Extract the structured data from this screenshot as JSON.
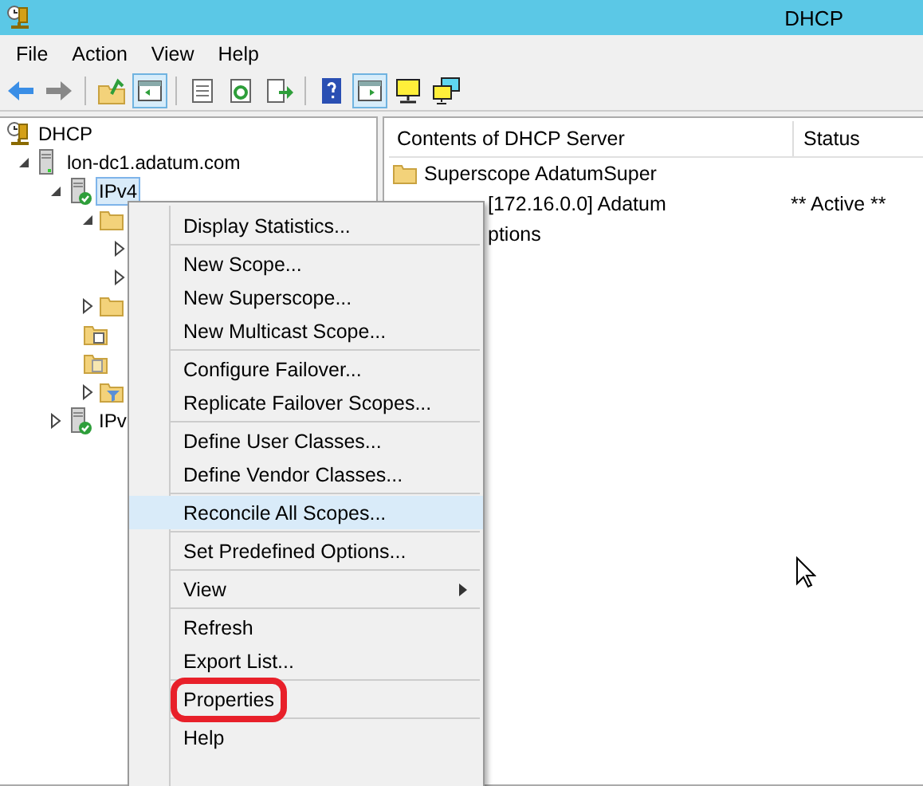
{
  "window": {
    "title": "DHCP"
  },
  "menu_bar": [
    "File",
    "Action",
    "View",
    "Help"
  ],
  "toolbar": [
    {
      "kind": "back",
      "pressed": false
    },
    {
      "kind": "forward",
      "pressed": false
    },
    {
      "kind": "sep"
    },
    {
      "kind": "up",
      "pressed": false
    },
    {
      "kind": "tree",
      "pressed": true
    },
    {
      "kind": "sep"
    },
    {
      "kind": "list",
      "pressed": false
    },
    {
      "kind": "refresh",
      "pressed": false
    },
    {
      "kind": "export",
      "pressed": false
    },
    {
      "kind": "sep"
    },
    {
      "kind": "help",
      "pressed": false
    },
    {
      "kind": "pane",
      "pressed": true
    },
    {
      "kind": "monitor",
      "pressed": false
    },
    {
      "kind": "monitors",
      "pressed": false
    }
  ],
  "tree": [
    {
      "label": "DHCP",
      "kind": "dhcp",
      "selected": false,
      "children": [
        {
          "label": "lon-dc1.adatum.com",
          "kind": "server",
          "expanded": true,
          "selected": false,
          "children": [
            {
              "label": "IPv4",
              "kind": "server-ok",
              "expanded": true,
              "selected": true,
              "children": [
                {
                  "kind": "folder",
                  "expanded": true,
                  "children": [
                    {
                      "expanded": false
                    },
                    {
                      "expanded": false
                    }
                  ]
                },
                {
                  "kind": "folder",
                  "expanded": false
                },
                {
                  "kind": "folder-table"
                },
                {
                  "kind": "folder-doc"
                },
                {
                  "kind": "folder-filter",
                  "expanded": false
                }
              ]
            },
            {
              "label": "IPv",
              "kind": "server-ok",
              "expanded": false,
              "selected": false
            }
          ]
        }
      ]
    }
  ],
  "list": {
    "columns": [
      "Contents of DHCP Server",
      "Status"
    ],
    "rows": [
      {
        "name": "Superscope AdatumSuper",
        "status": "",
        "covered": false
      },
      {
        "name": "[172.16.0.0] Adatum",
        "status": "** Active **",
        "covered": true
      },
      {
        "name": "ptions",
        "status": "",
        "covered": true
      }
    ]
  },
  "context_menu": [
    {
      "kind": "item",
      "label": "Display Statistics...",
      "selected": false,
      "circled": false
    },
    {
      "kind": "sep"
    },
    {
      "kind": "item",
      "label": "New Scope...",
      "selected": false,
      "circled": false
    },
    {
      "kind": "item",
      "label": "New Superscope...",
      "selected": false,
      "circled": false
    },
    {
      "kind": "item",
      "label": "New Multicast Scope...",
      "selected": false,
      "circled": false
    },
    {
      "kind": "sep"
    },
    {
      "kind": "item",
      "label": "Configure Failover...",
      "selected": false,
      "circled": false
    },
    {
      "kind": "item",
      "label": "Replicate Failover Scopes...",
      "selected": false,
      "circled": false
    },
    {
      "kind": "sep"
    },
    {
      "kind": "item",
      "label": "Define User Classes...",
      "selected": false,
      "circled": false
    },
    {
      "kind": "item",
      "label": "Define Vendor Classes...",
      "selected": false,
      "circled": false
    },
    {
      "kind": "sep"
    },
    {
      "kind": "item",
      "label": "Reconcile All Scopes...",
      "selected": true,
      "circled": false
    },
    {
      "kind": "sep"
    },
    {
      "kind": "item",
      "label": "Set Predefined Options...",
      "selected": false,
      "circled": false
    },
    {
      "kind": "sep"
    },
    {
      "kind": "submenu",
      "label": "View",
      "selected": false,
      "circled": false
    },
    {
      "kind": "sep"
    },
    {
      "kind": "item",
      "label": "Refresh",
      "selected": false,
      "circled": false
    },
    {
      "kind": "item",
      "label": "Export List...",
      "selected": false,
      "circled": false
    },
    {
      "kind": "sep"
    },
    {
      "kind": "item",
      "label": "Properties",
      "selected": false,
      "circled": true
    },
    {
      "kind": "sep"
    },
    {
      "kind": "item",
      "label": "Help",
      "selected": false,
      "circled": false
    }
  ]
}
